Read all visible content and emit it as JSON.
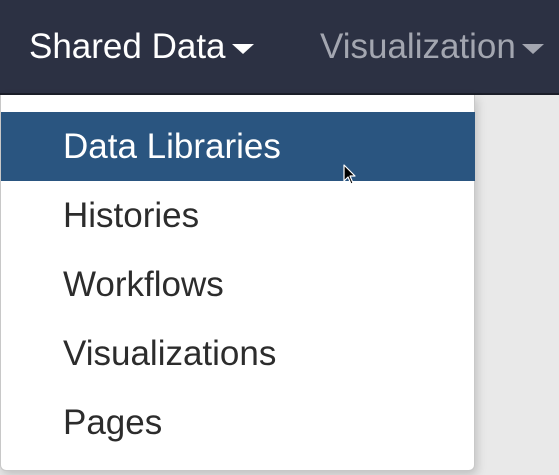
{
  "navbar": {
    "items": [
      {
        "label": "Shared Data",
        "icon": "caret-down-icon"
      },
      {
        "label": "Visualization",
        "icon": "caret-down-icon"
      }
    ]
  },
  "dropdown": {
    "items": [
      {
        "label": "Data Libraries",
        "active": true
      },
      {
        "label": "Histories"
      },
      {
        "label": "Workflows"
      },
      {
        "label": "Visualizations"
      },
      {
        "label": "Pages"
      }
    ]
  },
  "colors": {
    "navbar_bg": "#2c3143",
    "active_bg": "#2a5580",
    "nav_text": "#ffffff",
    "nav_text_muted": "#a3a6b0"
  }
}
